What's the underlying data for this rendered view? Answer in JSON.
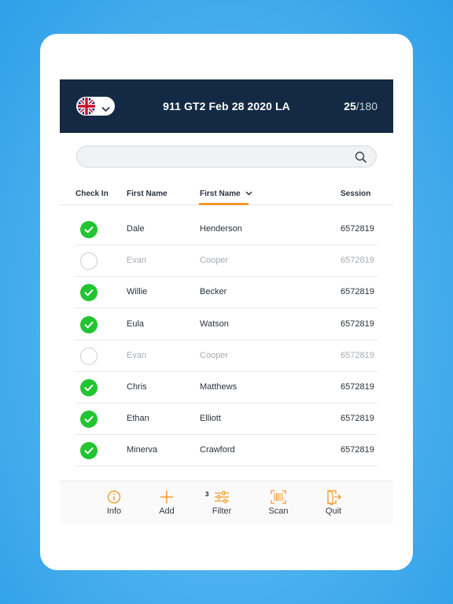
{
  "header": {
    "title": "911 GT2 Feb 28 2020 LA",
    "checked_count": "25",
    "total_count": "/180",
    "language_icon": "uk-flag-icon"
  },
  "search": {
    "placeholder": ""
  },
  "columns": {
    "check_in": "Check In",
    "first_name": "First Name",
    "sorted_name": "First Name",
    "session": "Session"
  },
  "rows": [
    {
      "checked": true,
      "first": "Dale",
      "last": "Henderson",
      "session": "6572819"
    },
    {
      "checked": false,
      "first": "Evan",
      "last": "Cooper",
      "session": "6572819"
    },
    {
      "checked": true,
      "first": "Willie",
      "last": "Becker",
      "session": "6572819"
    },
    {
      "checked": true,
      "first": "Eula",
      "last": "Watson",
      "session": "6572819"
    },
    {
      "checked": false,
      "first": "Evan",
      "last": "Cooper",
      "session": "6572819"
    },
    {
      "checked": true,
      "first": "Chris",
      "last": "Matthews",
      "session": "6572819"
    },
    {
      "checked": true,
      "first": "Ethan",
      "last": "Elliott",
      "session": "6572819"
    },
    {
      "checked": true,
      "first": "Minerva",
      "last": "Crawford",
      "session": "6572819"
    }
  ],
  "toolbar": {
    "info": "Info",
    "add": "Add",
    "filter": "Filter",
    "filter_badge": "3",
    "scan": "Scan",
    "quit": "Quit"
  },
  "colors": {
    "header_bg": "#142a44",
    "accent": "#f29b2b",
    "checked": "#22c531"
  }
}
